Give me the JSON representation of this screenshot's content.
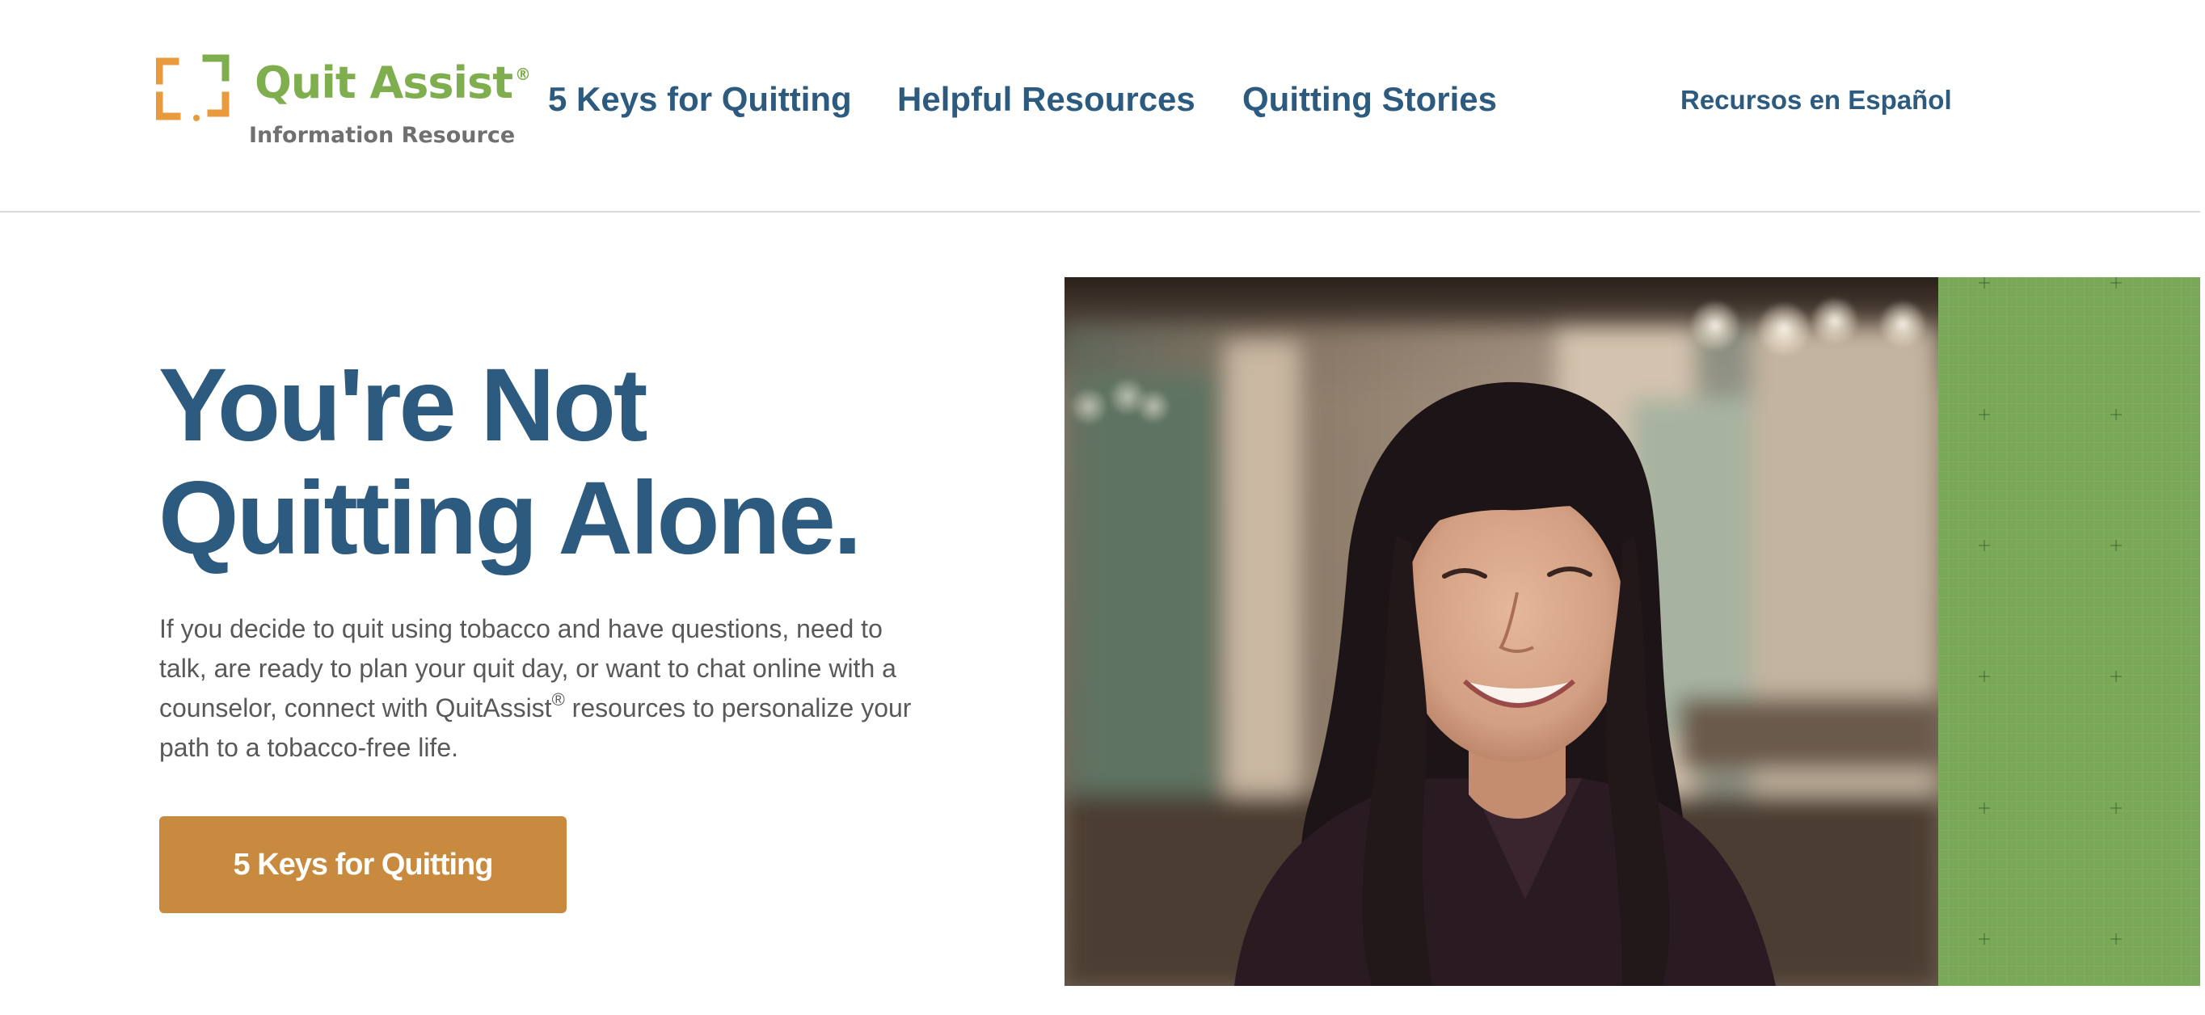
{
  "brand": {
    "name": "Quit Assist",
    "registered_mark": "®",
    "tagline": "Information Resource",
    "colors": {
      "orange": "#e99a3c",
      "green": "#7fae4f",
      "navy": "#2d5a7f",
      "gray": "#707070"
    }
  },
  "nav": {
    "items": [
      {
        "label": "5 Keys for Quitting"
      },
      {
        "label": "Helpful Resources"
      },
      {
        "label": "Quitting Stories"
      }
    ],
    "spanish": "Recursos en Español"
  },
  "hero": {
    "title_line1": "You're Not",
    "title_line2": "Quitting Alone.",
    "body_before": "If you decide to quit using tobacco and have questions, need to talk, are ready to plan your quit day, or want to chat online with a counselor, connect with QuitAssist",
    "body_mark": "®",
    "body_after": " resources to personalize your path to a tobacco-free life.",
    "cta_label": "5 Keys for Quitting",
    "cta_color": "#c88a3f",
    "panel_color": "#79a957",
    "photo_icon": "smiling-woman-photo"
  }
}
